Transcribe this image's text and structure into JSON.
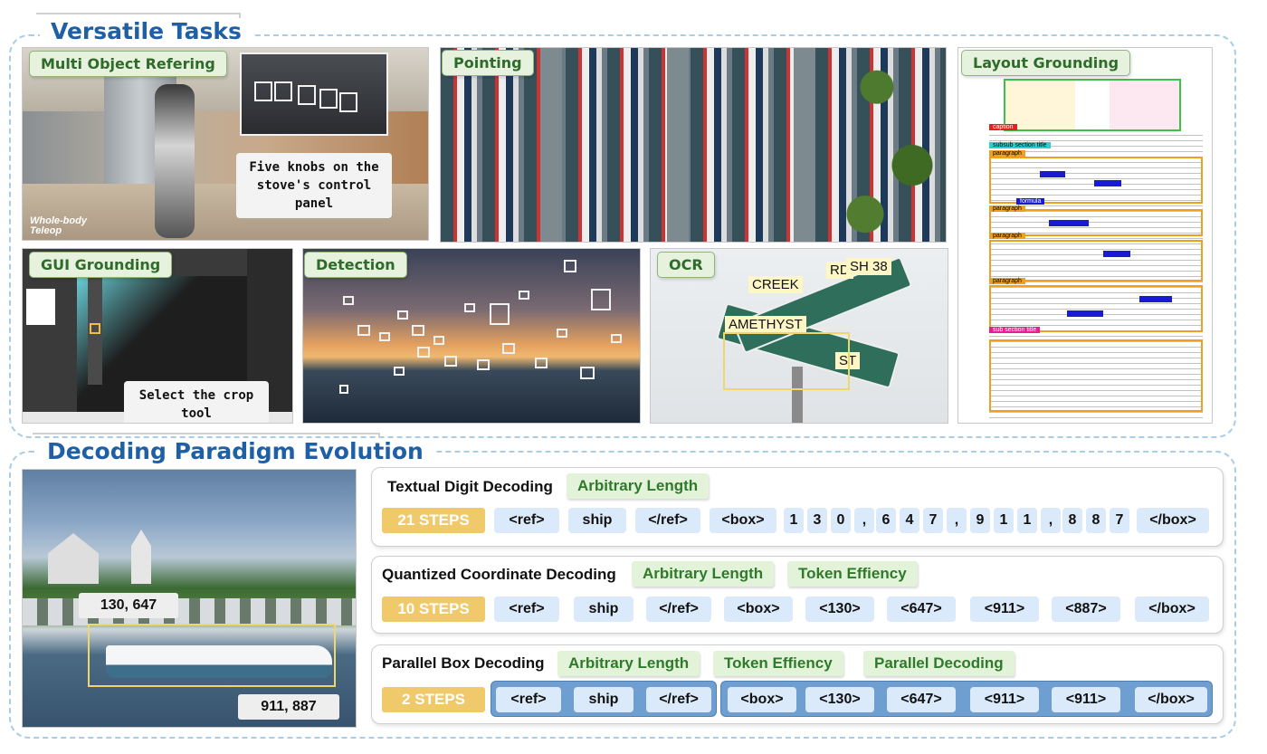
{
  "sections": {
    "versatile_title": "Versatile Tasks",
    "decoding_title": "Decoding Paradigm Evolution"
  },
  "tasks": {
    "multi_object": {
      "label": "Multi Object Refering",
      "caption": "Five knobs on the stove's control panel",
      "watermark_line1": "Whole-body",
      "watermark_line2": "Teleop"
    },
    "pointing": {
      "label": "Pointing"
    },
    "layout": {
      "label": "Layout Grounding",
      "tags": [
        "caption",
        "subsub section title",
        "paragraph",
        "formula",
        "paragraph",
        "paragraph",
        "paragraph",
        "sub section title"
      ]
    },
    "gui": {
      "label": "GUI Grounding",
      "caption": "Select the crop tool"
    },
    "detection": {
      "label": "Detection"
    },
    "ocr": {
      "label": "OCR",
      "words": [
        "CREEK",
        "RD",
        "SH 38",
        "AMETHYST",
        "ST"
      ]
    }
  },
  "ship_image": {
    "top_left": "130, 647",
    "bottom_right": "911, 887"
  },
  "decoding": [
    {
      "title": "Textual Digit Decoding",
      "badges": [
        "Arbitrary Length"
      ],
      "steps": "21 STEPS",
      "tokens": [
        "<ref>",
        "ship",
        "</ref>",
        "<box>",
        "1",
        "3",
        "0",
        ",",
        "6",
        "4",
        "7",
        ",",
        "9",
        "1",
        "1",
        ",",
        "8",
        "8",
        "7",
        "</box>"
      ]
    },
    {
      "title": "Quantized Coordinate Decoding",
      "badges": [
        "Arbitrary Length",
        "Token Effiency"
      ],
      "steps": "10 STEPS",
      "tokens": [
        "<ref>",
        "ship",
        "</ref>",
        "<box>",
        "<130>",
        "<647>",
        "<911>",
        "<887>",
        "</box>"
      ]
    },
    {
      "title": "Parallel Box Decoding",
      "badges": [
        "Arbitrary Length",
        "Token Effiency",
        "Parallel Decoding"
      ],
      "steps": "2 STEPS",
      "tokens": [
        "<ref>",
        "ship",
        "</ref>",
        "<box>",
        "<130>",
        "<647>",
        "<911>",
        "<911>",
        "</box>"
      ]
    }
  ],
  "colors": {
    "title_blue": "#1f5fa6",
    "tag_green": "#e6f2dd",
    "steps_yellow": "#f0c96a",
    "token_blue": "#dbeafa",
    "parallel_group": "#6f9fd0"
  }
}
